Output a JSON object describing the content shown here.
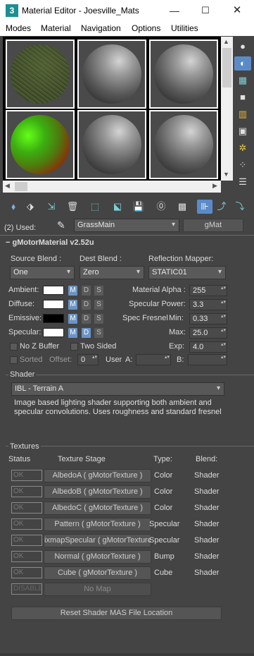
{
  "window": {
    "title": "Material Editor - Joesville_Mats",
    "app_icon": "3"
  },
  "menu": [
    "Modes",
    "Material",
    "Navigation",
    "Options",
    "Utilities"
  ],
  "slots": [
    "grass",
    "gray",
    "gray",
    "greenred",
    "gray",
    "gray"
  ],
  "used": {
    "label": "(2) Used:",
    "material_dropdown": "GrassMain",
    "material_button": "gMat"
  },
  "rollout": {
    "title": "gMotorMaterial v2.52u"
  },
  "blend": {
    "source_label": "Source Blend :",
    "source_value": "One",
    "dest_label": "Dest Blend :",
    "dest_value": "Zero",
    "reflection_label": "Reflection Mapper:",
    "reflection_value": "STATIC01"
  },
  "colors": [
    {
      "label": "Ambient:",
      "swatch": "#ffffff",
      "M": "M",
      "D": "D",
      "S": "S"
    },
    {
      "label": "Diffuse:",
      "swatch": "#ffffff",
      "M": "M",
      "D": "D",
      "S": "S"
    },
    {
      "label": "Emissive:",
      "swatch": "#000000",
      "M": "M",
      "D": "D",
      "S": "S"
    },
    {
      "label": "Specular:",
      "swatch": "#ffffff",
      "M": "M",
      "D": "D",
      "S": "S"
    }
  ],
  "params": {
    "alpha_label": "Material Alpha :",
    "alpha_value": "255",
    "specpower_label": "Specular Power:",
    "specpower_value": "3.3",
    "fresnel_label": "Spec Fresnel",
    "min_label": "Min:",
    "min_value": "0.33",
    "max_label": "Max:",
    "max_value": "25.0",
    "exp_label": "Exp:",
    "exp_value": "4.0"
  },
  "checks": {
    "nozbuffer": "No Z Buffer",
    "twosided": "Two Sided",
    "sorted": "Sorted",
    "offset_label": "Offset:",
    "offset_value": "0",
    "user_label": "User",
    "a_label": "A:",
    "b_label": "B:"
  },
  "shader": {
    "group": "Shader",
    "selected": "IBL - Terrain A",
    "description": "Image based lighting shader supporting both ambient and specular convolutions. Uses roughness and standard fresnel"
  },
  "textures": {
    "group": "Textures",
    "headers": {
      "status": "Status",
      "stage": "Texture Stage",
      "type": "Type:",
      "blend": "Blend:"
    },
    "rows": [
      {
        "status": "OK",
        "stage": "AlbedoA  ( gMotorTexture )",
        "type": "Color",
        "blend": "Shader"
      },
      {
        "status": "OK",
        "stage": "AlbedoB  ( gMotorTexture )",
        "type": "Color",
        "blend": "Shader"
      },
      {
        "status": "OK",
        "stage": "AlbedoC  ( gMotorTexture )",
        "type": "Color",
        "blend": "Shader"
      },
      {
        "status": "OK",
        "stage": "Pattern  ( gMotorTexture )",
        "type": "Specular",
        "blend": "Shader"
      },
      {
        "status": "OK",
        "stage": "ixmapSpecular  ( gMotorTexture )",
        "type": "Specular",
        "blend": "Shader"
      },
      {
        "status": "OK",
        "stage": "Normal  ( gMotorTexture )",
        "type": "Bump",
        "blend": "Shader"
      },
      {
        "status": "OK",
        "stage": "Cube  ( gMotorTexture )",
        "type": "Cube",
        "blend": "Shader"
      },
      {
        "status": "DISABLED",
        "stage": "No Map",
        "type": "",
        "blend": ""
      }
    ]
  },
  "reset_button": "Reset Shader MAS File Location",
  "accent": "#6b93c6"
}
